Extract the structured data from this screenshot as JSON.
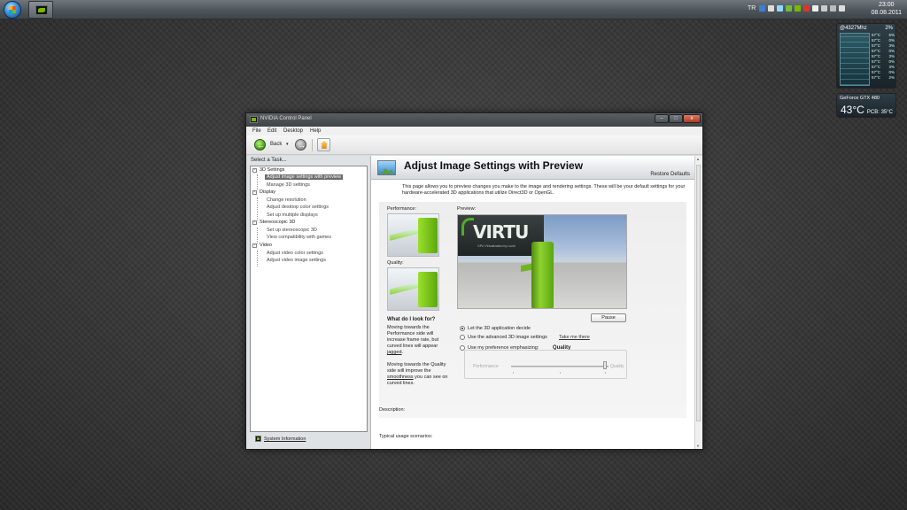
{
  "taskbar": {
    "language": "TR",
    "clock_time": "23:00",
    "clock_date": "08.08.2011"
  },
  "gadgets": {
    "cpu": {
      "header": "@4327Mhz",
      "usage": "2%",
      "rows": [
        {
          "temp": "57°C",
          "load": "5%"
        },
        {
          "temp": "57°C",
          "load": "0%"
        },
        {
          "temp": "57°C",
          "load": "3%"
        },
        {
          "temp": "57°C",
          "load": "0%"
        },
        {
          "temp": "57°C",
          "load": "3%"
        },
        {
          "temp": "57°C",
          "load": "0%"
        },
        {
          "temp": "57°C",
          "load": "3%"
        },
        {
          "temp": "57°C",
          "load": "0%"
        },
        {
          "temp": "57°C",
          "load": "2%"
        }
      ]
    },
    "gpu": {
      "name": "GeForce GTX 480",
      "temp": "43°C",
      "pcb": "PCB: 35°C"
    }
  },
  "window": {
    "title": "NVIDIA Control Panel",
    "buttons": {
      "minimize": "–",
      "maximize": "□",
      "close": "x"
    },
    "menu": [
      "File",
      "Edit",
      "Desktop",
      "Help"
    ],
    "toolbar": {
      "back_label": "Back",
      "dropdown": "▾"
    },
    "left_pane": {
      "heading": "Select a Task...",
      "tree": [
        {
          "label": "3D Settings",
          "type": "category"
        },
        {
          "label": "Adjust image settings with preview",
          "type": "item",
          "selected": true
        },
        {
          "label": "Manage 3D settings",
          "type": "item"
        },
        {
          "label": "Display",
          "type": "category"
        },
        {
          "label": "Change resolution",
          "type": "item"
        },
        {
          "label": "Adjust desktop color settings",
          "type": "item"
        },
        {
          "label": "Set up multiple displays",
          "type": "item"
        },
        {
          "label": "Stereoscopic 3D",
          "type": "category"
        },
        {
          "label": "Set up stereoscopic 3D",
          "type": "item"
        },
        {
          "label": "View compatibility with games",
          "type": "item"
        },
        {
          "label": "Video",
          "type": "category"
        },
        {
          "label": "Adjust video color settings",
          "type": "item"
        },
        {
          "label": "Adjust video image settings",
          "type": "item"
        }
      ],
      "system_information": "System Information"
    },
    "right_pane": {
      "title": "Adjust Image Settings with Preview",
      "restore_defaults": "Restore Defaults",
      "intro": "This page allows you to preview changes you make to the image and rendering settings. These will be your default settings for your hardware-accelerated 3D applications that utilize Direct3D or OpenGL.",
      "performance_label": "Performance:",
      "quality_label": "Quality:",
      "preview_label": "Preview:",
      "virtu": {
        "logo": "VIRTU",
        "sub": "GPU  Virtualization",
        "by": "by Lucid"
      },
      "what_title": "What do I look for?",
      "what_text_a": "Moving towards the Performance side will increase frame rate, but curved lines will appear ",
      "what_link_a": "jagged",
      "what_text_b": "Moving towards the Quality side will improve the ",
      "what_link_b": "smoothness",
      "what_text_b2": " you can see on curved lines.",
      "pause": "Pause",
      "radios": [
        {
          "label": "Let the 3D application decide",
          "checked": true
        },
        {
          "label": "Use the advanced 3D image settings",
          "checked": false
        },
        {
          "label": "Use my preference emphasizing:",
          "checked": false
        }
      ],
      "take_me_there": "Take me there",
      "emphasis_value": "Quality",
      "slider": {
        "left": "Performance",
        "right": "Quality",
        "value": 1.0
      },
      "description_label": "Description:",
      "usage_label": "Typical usage scenarios:"
    }
  }
}
